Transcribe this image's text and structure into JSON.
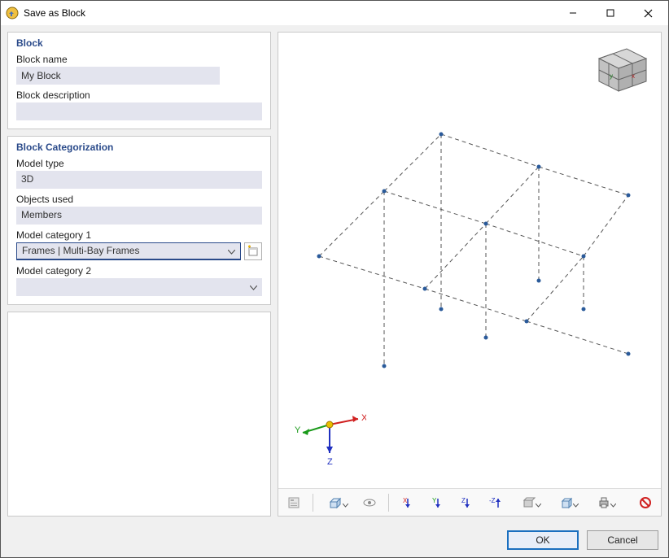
{
  "titlebar": {
    "title": "Save as Block"
  },
  "block_panel": {
    "title": "Block",
    "name_label": "Block name",
    "name_value": "My Block",
    "desc_label": "Block description",
    "desc_value": ""
  },
  "cat_panel": {
    "title": "Block Categorization",
    "model_type_label": "Model type",
    "model_type_value": "3D",
    "objects_label": "Objects used",
    "objects_value": "Members",
    "cat1_label": "Model category 1",
    "cat1_value": "Frames | Multi-Bay Frames",
    "cat2_label": "Model category 2",
    "cat2_value": ""
  },
  "csys": {
    "x": "X",
    "y": "Y",
    "z": "Z"
  },
  "navcube": {
    "x": "x",
    "y": "y"
  },
  "footer": {
    "ok": "OK",
    "cancel": "Cancel"
  }
}
